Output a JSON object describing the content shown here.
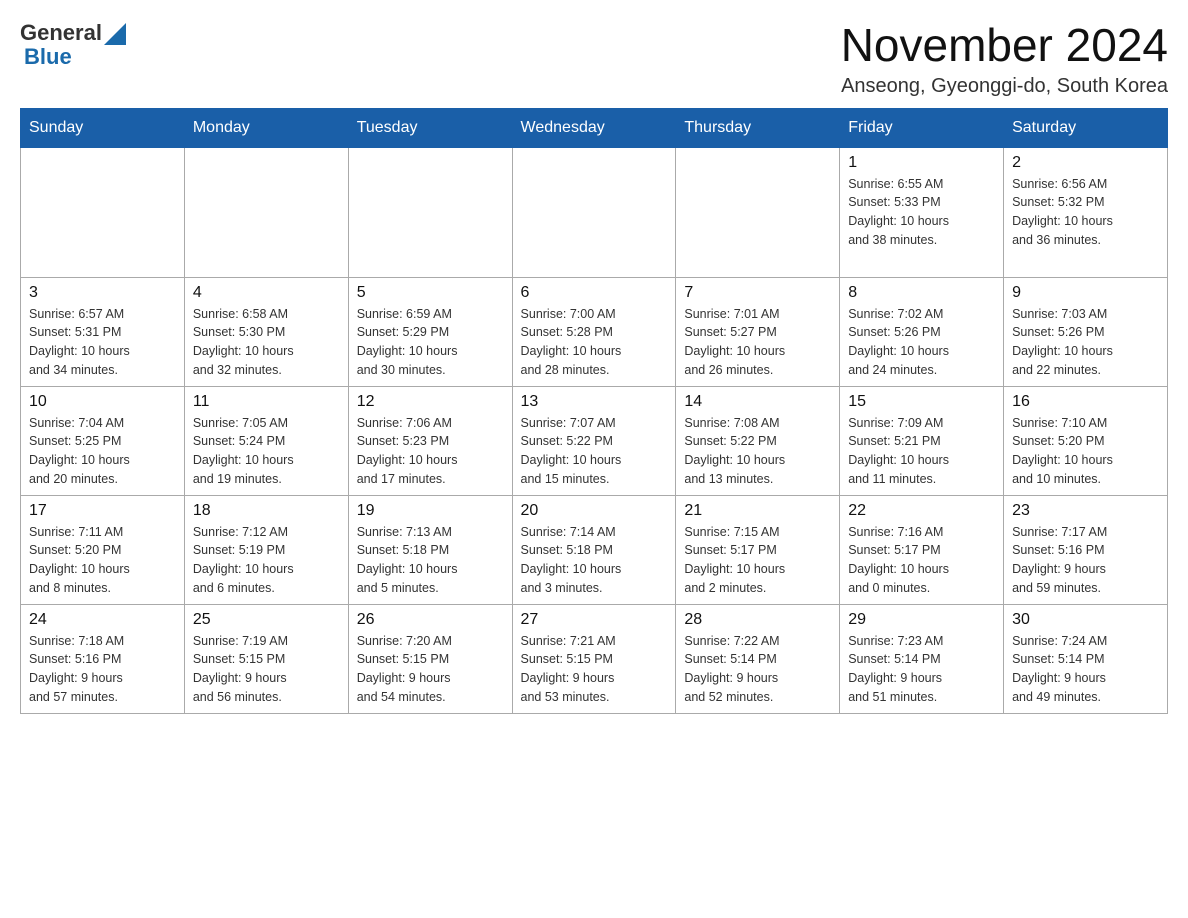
{
  "header": {
    "logo": {
      "general": "General",
      "blue": "Blue"
    },
    "title": "November 2024",
    "location": "Anseong, Gyeonggi-do, South Korea"
  },
  "weekdays": [
    "Sunday",
    "Monday",
    "Tuesday",
    "Wednesday",
    "Thursday",
    "Friday",
    "Saturday"
  ],
  "weeks": [
    [
      {
        "day": "",
        "info": ""
      },
      {
        "day": "",
        "info": ""
      },
      {
        "day": "",
        "info": ""
      },
      {
        "day": "",
        "info": ""
      },
      {
        "day": "",
        "info": ""
      },
      {
        "day": "1",
        "info": "Sunrise: 6:55 AM\nSunset: 5:33 PM\nDaylight: 10 hours\nand 38 minutes."
      },
      {
        "day": "2",
        "info": "Sunrise: 6:56 AM\nSunset: 5:32 PM\nDaylight: 10 hours\nand 36 minutes."
      }
    ],
    [
      {
        "day": "3",
        "info": "Sunrise: 6:57 AM\nSunset: 5:31 PM\nDaylight: 10 hours\nand 34 minutes."
      },
      {
        "day": "4",
        "info": "Sunrise: 6:58 AM\nSunset: 5:30 PM\nDaylight: 10 hours\nand 32 minutes."
      },
      {
        "day": "5",
        "info": "Sunrise: 6:59 AM\nSunset: 5:29 PM\nDaylight: 10 hours\nand 30 minutes."
      },
      {
        "day": "6",
        "info": "Sunrise: 7:00 AM\nSunset: 5:28 PM\nDaylight: 10 hours\nand 28 minutes."
      },
      {
        "day": "7",
        "info": "Sunrise: 7:01 AM\nSunset: 5:27 PM\nDaylight: 10 hours\nand 26 minutes."
      },
      {
        "day": "8",
        "info": "Sunrise: 7:02 AM\nSunset: 5:26 PM\nDaylight: 10 hours\nand 24 minutes."
      },
      {
        "day": "9",
        "info": "Sunrise: 7:03 AM\nSunset: 5:26 PM\nDaylight: 10 hours\nand 22 minutes."
      }
    ],
    [
      {
        "day": "10",
        "info": "Sunrise: 7:04 AM\nSunset: 5:25 PM\nDaylight: 10 hours\nand 20 minutes."
      },
      {
        "day": "11",
        "info": "Sunrise: 7:05 AM\nSunset: 5:24 PM\nDaylight: 10 hours\nand 19 minutes."
      },
      {
        "day": "12",
        "info": "Sunrise: 7:06 AM\nSunset: 5:23 PM\nDaylight: 10 hours\nand 17 minutes."
      },
      {
        "day": "13",
        "info": "Sunrise: 7:07 AM\nSunset: 5:22 PM\nDaylight: 10 hours\nand 15 minutes."
      },
      {
        "day": "14",
        "info": "Sunrise: 7:08 AM\nSunset: 5:22 PM\nDaylight: 10 hours\nand 13 minutes."
      },
      {
        "day": "15",
        "info": "Sunrise: 7:09 AM\nSunset: 5:21 PM\nDaylight: 10 hours\nand 11 minutes."
      },
      {
        "day": "16",
        "info": "Sunrise: 7:10 AM\nSunset: 5:20 PM\nDaylight: 10 hours\nand 10 minutes."
      }
    ],
    [
      {
        "day": "17",
        "info": "Sunrise: 7:11 AM\nSunset: 5:20 PM\nDaylight: 10 hours\nand 8 minutes."
      },
      {
        "day": "18",
        "info": "Sunrise: 7:12 AM\nSunset: 5:19 PM\nDaylight: 10 hours\nand 6 minutes."
      },
      {
        "day": "19",
        "info": "Sunrise: 7:13 AM\nSunset: 5:18 PM\nDaylight: 10 hours\nand 5 minutes."
      },
      {
        "day": "20",
        "info": "Sunrise: 7:14 AM\nSunset: 5:18 PM\nDaylight: 10 hours\nand 3 minutes."
      },
      {
        "day": "21",
        "info": "Sunrise: 7:15 AM\nSunset: 5:17 PM\nDaylight: 10 hours\nand 2 minutes."
      },
      {
        "day": "22",
        "info": "Sunrise: 7:16 AM\nSunset: 5:17 PM\nDaylight: 10 hours\nand 0 minutes."
      },
      {
        "day": "23",
        "info": "Sunrise: 7:17 AM\nSunset: 5:16 PM\nDaylight: 9 hours\nand 59 minutes."
      }
    ],
    [
      {
        "day": "24",
        "info": "Sunrise: 7:18 AM\nSunset: 5:16 PM\nDaylight: 9 hours\nand 57 minutes."
      },
      {
        "day": "25",
        "info": "Sunrise: 7:19 AM\nSunset: 5:15 PM\nDaylight: 9 hours\nand 56 minutes."
      },
      {
        "day": "26",
        "info": "Sunrise: 7:20 AM\nSunset: 5:15 PM\nDaylight: 9 hours\nand 54 minutes."
      },
      {
        "day": "27",
        "info": "Sunrise: 7:21 AM\nSunset: 5:15 PM\nDaylight: 9 hours\nand 53 minutes."
      },
      {
        "day": "28",
        "info": "Sunrise: 7:22 AM\nSunset: 5:14 PM\nDaylight: 9 hours\nand 52 minutes."
      },
      {
        "day": "29",
        "info": "Sunrise: 7:23 AM\nSunset: 5:14 PM\nDaylight: 9 hours\nand 51 minutes."
      },
      {
        "day": "30",
        "info": "Sunrise: 7:24 AM\nSunset: 5:14 PM\nDaylight: 9 hours\nand 49 minutes."
      }
    ]
  ]
}
